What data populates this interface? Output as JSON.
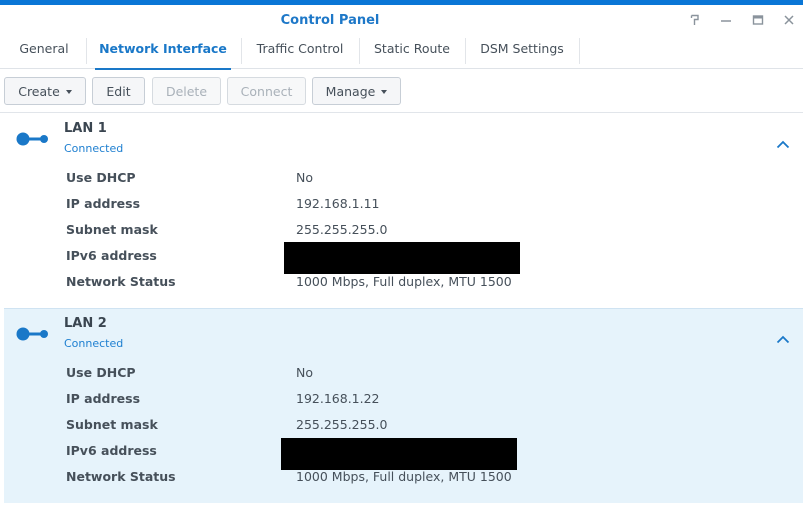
{
  "window": {
    "title": "Control Panel",
    "controls": [
      "help-icon",
      "minimize-icon",
      "maximize-icon",
      "close-icon"
    ]
  },
  "tabs": [
    {
      "label": "General",
      "active": false
    },
    {
      "label": "Network Interface",
      "active": true
    },
    {
      "label": "Traffic Control",
      "active": false
    },
    {
      "label": "Static Route",
      "active": false
    },
    {
      "label": "DSM Settings",
      "active": false
    }
  ],
  "toolbar": {
    "create": "Create",
    "edit": "Edit",
    "delete": "Delete",
    "connect": "Connect",
    "manage": "Manage"
  },
  "interfaces": [
    {
      "name": "LAN 1",
      "status": "Connected",
      "selected": false,
      "rows": [
        {
          "label": "Use DHCP",
          "value": "No"
        },
        {
          "label": "IP address",
          "value": "192.168.1.11"
        },
        {
          "label": "Subnet mask",
          "value": "255.255.255.0"
        },
        {
          "label": "IPv6 address",
          "value": ""
        },
        {
          "label": "Network Status",
          "value": "1000 Mbps, Full duplex, MTU 1500"
        }
      ]
    },
    {
      "name": "LAN 2",
      "status": "Connected",
      "selected": true,
      "rows": [
        {
          "label": "Use DHCP",
          "value": "No"
        },
        {
          "label": "IP address",
          "value": "192.168.1.22"
        },
        {
          "label": "Subnet mask",
          "value": "255.255.255.0"
        },
        {
          "label": "IPv6 address",
          "value": ""
        },
        {
          "label": "Network Status",
          "value": "1000 Mbps, Full duplex, MTU 1500"
        }
      ]
    }
  ],
  "colors": {
    "accent": "#1a78c8",
    "topbar": "#0a76d6",
    "selected_row": "#e6f3fb",
    "redaction": "#000000"
  }
}
